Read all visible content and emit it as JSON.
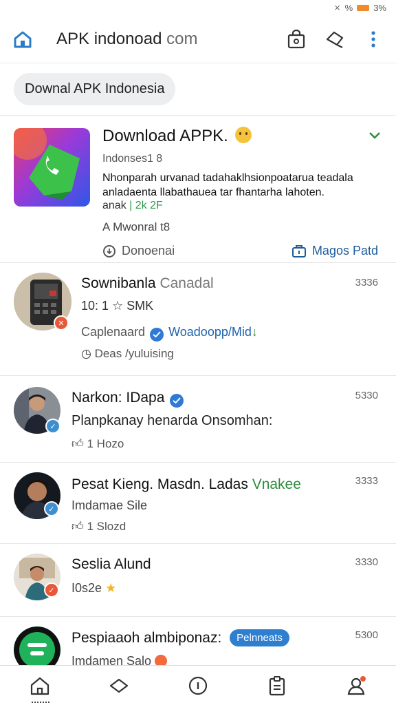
{
  "status_bar": {
    "signal": "⨯",
    "battery_text": "%",
    "battery_level": "3%"
  },
  "topbar": {
    "url_main": "APK indonoad",
    "url_suffix": " com"
  },
  "chip": {
    "label": "Downal APK Indonesia"
  },
  "featured": {
    "title": "Download APPK.",
    "subtitle": "Indonses1 8",
    "desc_line1": "Nhonparah urvanad tadahaklhsionpoatarua teadala",
    "desc_line2": "anladaenta llabathauea tar fhantarha lahoten.",
    "size_prefix": "anak",
    "size_value": "| 2k 2F",
    "meta": "A Mwonral t8",
    "left_action_label": "Donoenai",
    "right_action_label": "Magos Patd",
    "colors": {
      "accent": "#2e9b48",
      "link": "#1e5b9a"
    }
  },
  "feed": [
    {
      "name": "Sownibanla",
      "name_suffix": "Canadal",
      "time": "3336",
      "line1": "10: 1 ☆ SMK",
      "line2_prefix": "Caplenaard",
      "line2_link": "Woadoopp/Mid",
      "line2_arrow": "↓",
      "line3": "Deas /yuluising",
      "badge_color": "#e8593a"
    },
    {
      "name": "Narkon: IDapa",
      "time": "5330",
      "line1": "Planpkanay henarda Onsomhan:",
      "line2": "1 Hozo",
      "badge_color": "#3d8fd0"
    },
    {
      "name": "Pesat Kieng. Masdn. Ladas",
      "name_green": "Vnakee",
      "time": "3333",
      "line1": "Imdamae Sile",
      "line2": "1 Slozd",
      "badge_color": "#3d8fd0"
    },
    {
      "name": "Seslia Alund",
      "time": "3330",
      "line1": "I0s2e",
      "badge_color": "#e8593a"
    },
    {
      "name": "Pespiaaoh almbiponaz:",
      "pill": "Pelnneats",
      "time": "5300",
      "line1": "Imdamen Salo",
      "badge_color": "#e8593a"
    }
  ],
  "bottom_nav": [
    "home-icon",
    "diamond-icon",
    "info-icon",
    "clipboard-icon",
    "profile-icon"
  ]
}
